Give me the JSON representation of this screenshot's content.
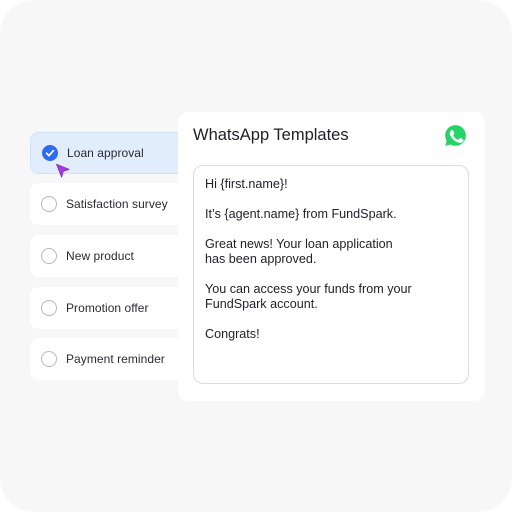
{
  "templates": [
    {
      "label": "Loan approval",
      "selected": true
    },
    {
      "label": "Satisfaction survey",
      "selected": false
    },
    {
      "label": "New product",
      "selected": false
    },
    {
      "label": "Promotion offer",
      "selected": false
    },
    {
      "label": "Payment reminder",
      "selected": false
    }
  ],
  "panel": {
    "title": "WhatsApp Templates",
    "icon": "whatsapp-icon",
    "message": [
      "Hi {first.name}!",
      "It’s {agent.name} from FundSpark.",
      "Great news! Your loan application\nhas been approved.",
      "You can access your funds from your\nFundSpark account.",
      "Congrats!"
    ]
  },
  "colors": {
    "accent": "#2f6bf0",
    "selected_bg": "#e2edfc",
    "whatsapp_green": "#25d366",
    "cursor_purple": "#a23ed6"
  }
}
